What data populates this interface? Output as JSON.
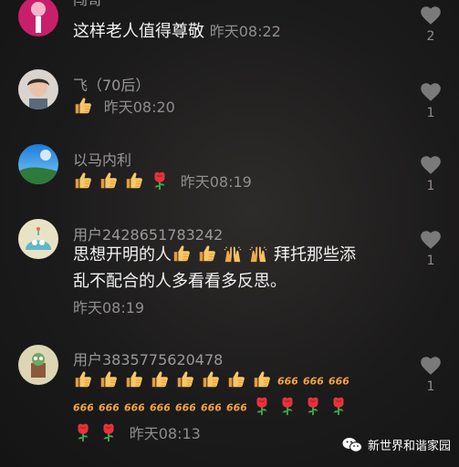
{
  "comments": [
    {
      "name": "闯哥",
      "text": "这样老人值得尊敬",
      "time": "昨天08:22",
      "likes": "2"
    },
    {
      "name": "飞（70后）",
      "time": "昨天08:20",
      "likes": "1"
    },
    {
      "name": "以马内利",
      "time": "昨天08:19",
      "likes": "1"
    },
    {
      "name": "用户2428651783242",
      "text_a": "思想开明的人",
      "text_b": "拜托那些添",
      "text_c": "乱不配合的人多看看多反思。",
      "time": "昨天08:19",
      "likes": "1"
    },
    {
      "name": "用户3835775620478",
      "time": "昨天08:13",
      "likes": "1"
    }
  ],
  "watermark": {
    "label": "新世界和谐家园"
  },
  "colors": {
    "background": "#1c1b1b",
    "name_text": "#9a9898",
    "body_text": "#f2f2f2",
    "heart": "#7a7a7a"
  },
  "icons": [
    "heart-icon",
    "thumbs-up-icon",
    "rose-icon",
    "praise-hands-icon",
    "666-icon",
    "wechat-logo-icon"
  ]
}
